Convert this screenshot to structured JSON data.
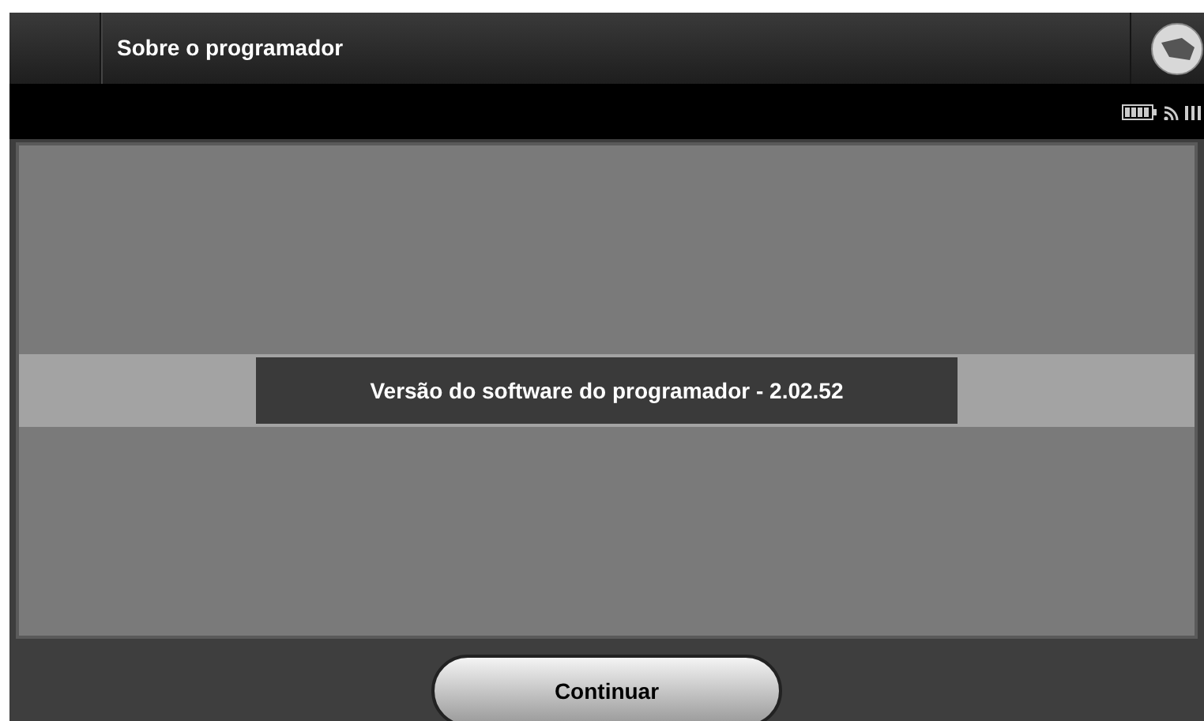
{
  "header": {
    "title": "Sobre o programador"
  },
  "message": "Versão do software do programador - 2.02.52",
  "buttons": [
    {
      "label": "Continuar"
    }
  ]
}
